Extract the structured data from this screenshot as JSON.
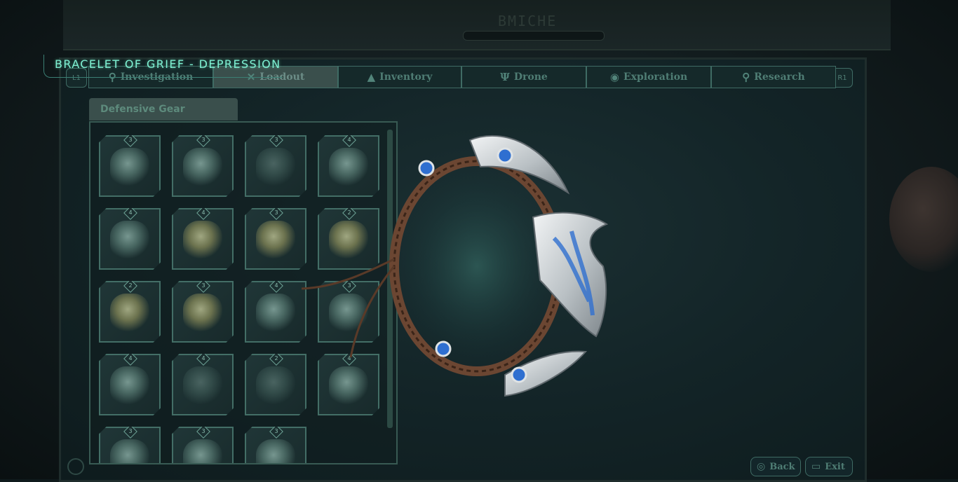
{
  "title": "BRACELET OF GRIEF - DEPRESSION",
  "device_label": "BMICHE",
  "tabs": [
    {
      "label": "Investigation",
      "icon": "investigation-icon",
      "active": false
    },
    {
      "label": "Loadout",
      "icon": "loadout-icon",
      "active": true
    },
    {
      "label": "Inventory",
      "icon": "inventory-icon",
      "active": false
    },
    {
      "label": "Drone",
      "icon": "drone-icon",
      "active": false
    },
    {
      "label": "Exploration",
      "icon": "exploration-icon",
      "active": false
    },
    {
      "label": "Research",
      "icon": "research-icon",
      "active": false
    }
  ],
  "shoulder_left": "L1",
  "shoulder_right": "R1",
  "category": "Defensive Gear",
  "grid": {
    "rows": [
      [
        {
          "level": "3",
          "tint": "normal"
        },
        {
          "level": "3",
          "tint": "normal"
        },
        {
          "level": "3",
          "tint": "dark"
        },
        {
          "level": "4",
          "tint": "normal"
        }
      ],
      [
        {
          "level": "4",
          "tint": "normal"
        },
        {
          "level": "4",
          "tint": "gold"
        },
        {
          "level": "3",
          "tint": "gold"
        },
        {
          "level": "2",
          "tint": "gold"
        }
      ],
      [
        {
          "level": "2",
          "tint": "gold"
        },
        {
          "level": "3",
          "tint": "gold"
        },
        {
          "level": "4",
          "tint": "normal"
        },
        {
          "level": "3",
          "tint": "normal"
        }
      ],
      [
        {
          "level": "4",
          "tint": "normal"
        },
        {
          "level": "4",
          "tint": "dark"
        },
        {
          "level": "2",
          "tint": "dark"
        },
        {
          "level": "4",
          "tint": "normal"
        }
      ],
      [
        {
          "level": "3",
          "tint": "normal"
        },
        {
          "level": "3",
          "tint": "normal"
        },
        {
          "level": "3",
          "tint": "normal"
        }
      ]
    ]
  },
  "buttons": {
    "back": "Back",
    "exit": "Exit"
  },
  "colors": {
    "accent": "#7ff1d3",
    "frame": "#3f6b64",
    "bead": "#2f6fd0",
    "silver": "#d9dde0"
  }
}
